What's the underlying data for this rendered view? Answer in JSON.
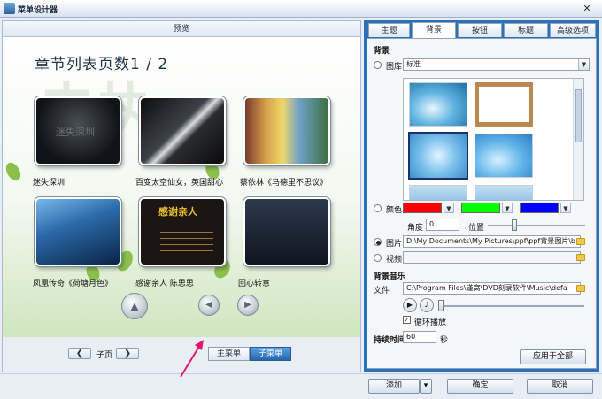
{
  "window": {
    "title": "菜单设计器",
    "close_symbol": "✕"
  },
  "preview": {
    "header": "预览",
    "page_heading": "章节列表页数1 / 2",
    "watermark": "未执",
    "thumbnails": [
      {
        "caption": "迷失深圳",
        "overlay_text": "迷失深圳"
      },
      {
        "caption": "百变太空仙女，英国甜心"
      },
      {
        "caption": "蔡依林《马德里不思议》"
      },
      {
        "caption": "凤凰传奇《荷塘月色》"
      },
      {
        "caption": "感谢亲人 陈思思",
        "overlay_title": "感谢亲人"
      },
      {
        "caption": "回心转意"
      }
    ],
    "nav_up_symbol": "▲",
    "nav_left_symbol": "◀",
    "nav_right_symbol": "▶",
    "subpage_label": "子页",
    "prev_symbol": "❮",
    "next_symbol": "❯",
    "main_menu_label": "主菜单",
    "sub_menu_label": "子菜单"
  },
  "settings": {
    "tabs": [
      "主题",
      "背景",
      "按钮",
      "标题",
      "高级选项"
    ],
    "active_tab": 1,
    "bg_section": "背景",
    "library_label": "图库",
    "library_value": "标准",
    "color_label": "颜色",
    "colors": [
      "#ff0000",
      "#00ff00",
      "#0000ff"
    ],
    "angle_label": "角度",
    "angle_value": "0",
    "position_label": "位置",
    "image_label": "图片",
    "image_path": "D:\\My Documents\\My Pictures\\ppf\\ppf背景图片\\b",
    "video_label": "视频",
    "video_path": "",
    "music_section": "背景音乐",
    "file_label": "文件",
    "music_path": "C:\\Program Files\\谨窝\\DVD刻录软件\\Music\\defa",
    "loop_label": "循环播放",
    "loop_checked": true,
    "duration_label": "持续时间",
    "duration_value": "60",
    "seconds_label": "秒",
    "apply_all_label": "应用于全部"
  },
  "bottom": {
    "add_label": "添加",
    "ok_label": "确定",
    "cancel_label": "取消"
  },
  "accent_color": "#2a72b8",
  "annotation_arrow_color": "#e0186e"
}
